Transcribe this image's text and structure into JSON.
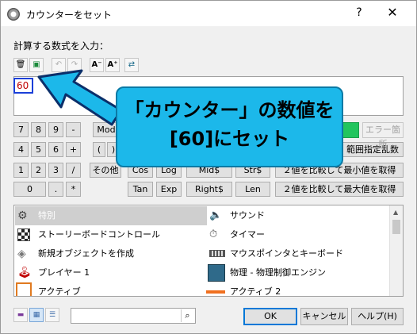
{
  "window": {
    "title": "カウンターをセット",
    "help_label": "?",
    "close_label": "✕"
  },
  "prompt": "計算する数式を入力：",
  "toolbar": {
    "icons": [
      "trash-icon",
      "insert-icon",
      "undo-icon",
      "redo-icon",
      "font-smaller-icon",
      "font-larger-icon",
      "wrap-icon"
    ]
  },
  "editor": {
    "value": "60",
    "value_color": "#c00000",
    "highlight_color": "#1a3fd8"
  },
  "keypad": {
    "row1": [
      "7",
      "8",
      "9",
      "-",
      "Mod"
    ],
    "row2": [
      "4",
      "5",
      "6",
      "+",
      "(",
      ")"
    ],
    "row3": [
      "1",
      "2",
      "3",
      "/",
      "その他",
      "Cos",
      "Log",
      "Mid$",
      "Str$",
      "２値を比較して最小値を取得"
    ],
    "row4": [
      "0",
      ".",
      "*",
      "Tan",
      "Exp",
      "Right$",
      "Len",
      "２値を比較して最大値を取得"
    ],
    "range_random_label": "範囲指定乱数",
    "error_label": "エラー箇所",
    "status_color": "#22c55e"
  },
  "object_list": {
    "items_left": [
      "特別",
      "ストーリーボードコントロール",
      "新規オブジェクトを作成",
      "プレイヤー 1",
      "アクティブ"
    ],
    "items_right": [
      "サウンド",
      "タイマー",
      "マウスポインタとキーボード",
      "物理 - 物理制御エンジン",
      "アクティブ 2"
    ]
  },
  "bottom": {
    "search_placeholder": "",
    "ok_label": "OK",
    "cancel_label": "キャンセル",
    "help_label": "ヘルプ(H)"
  },
  "callout": {
    "line1": "「カウンター」の数値を",
    "line2": "[60]にセット",
    "fill_color": "#1cb8ea"
  }
}
